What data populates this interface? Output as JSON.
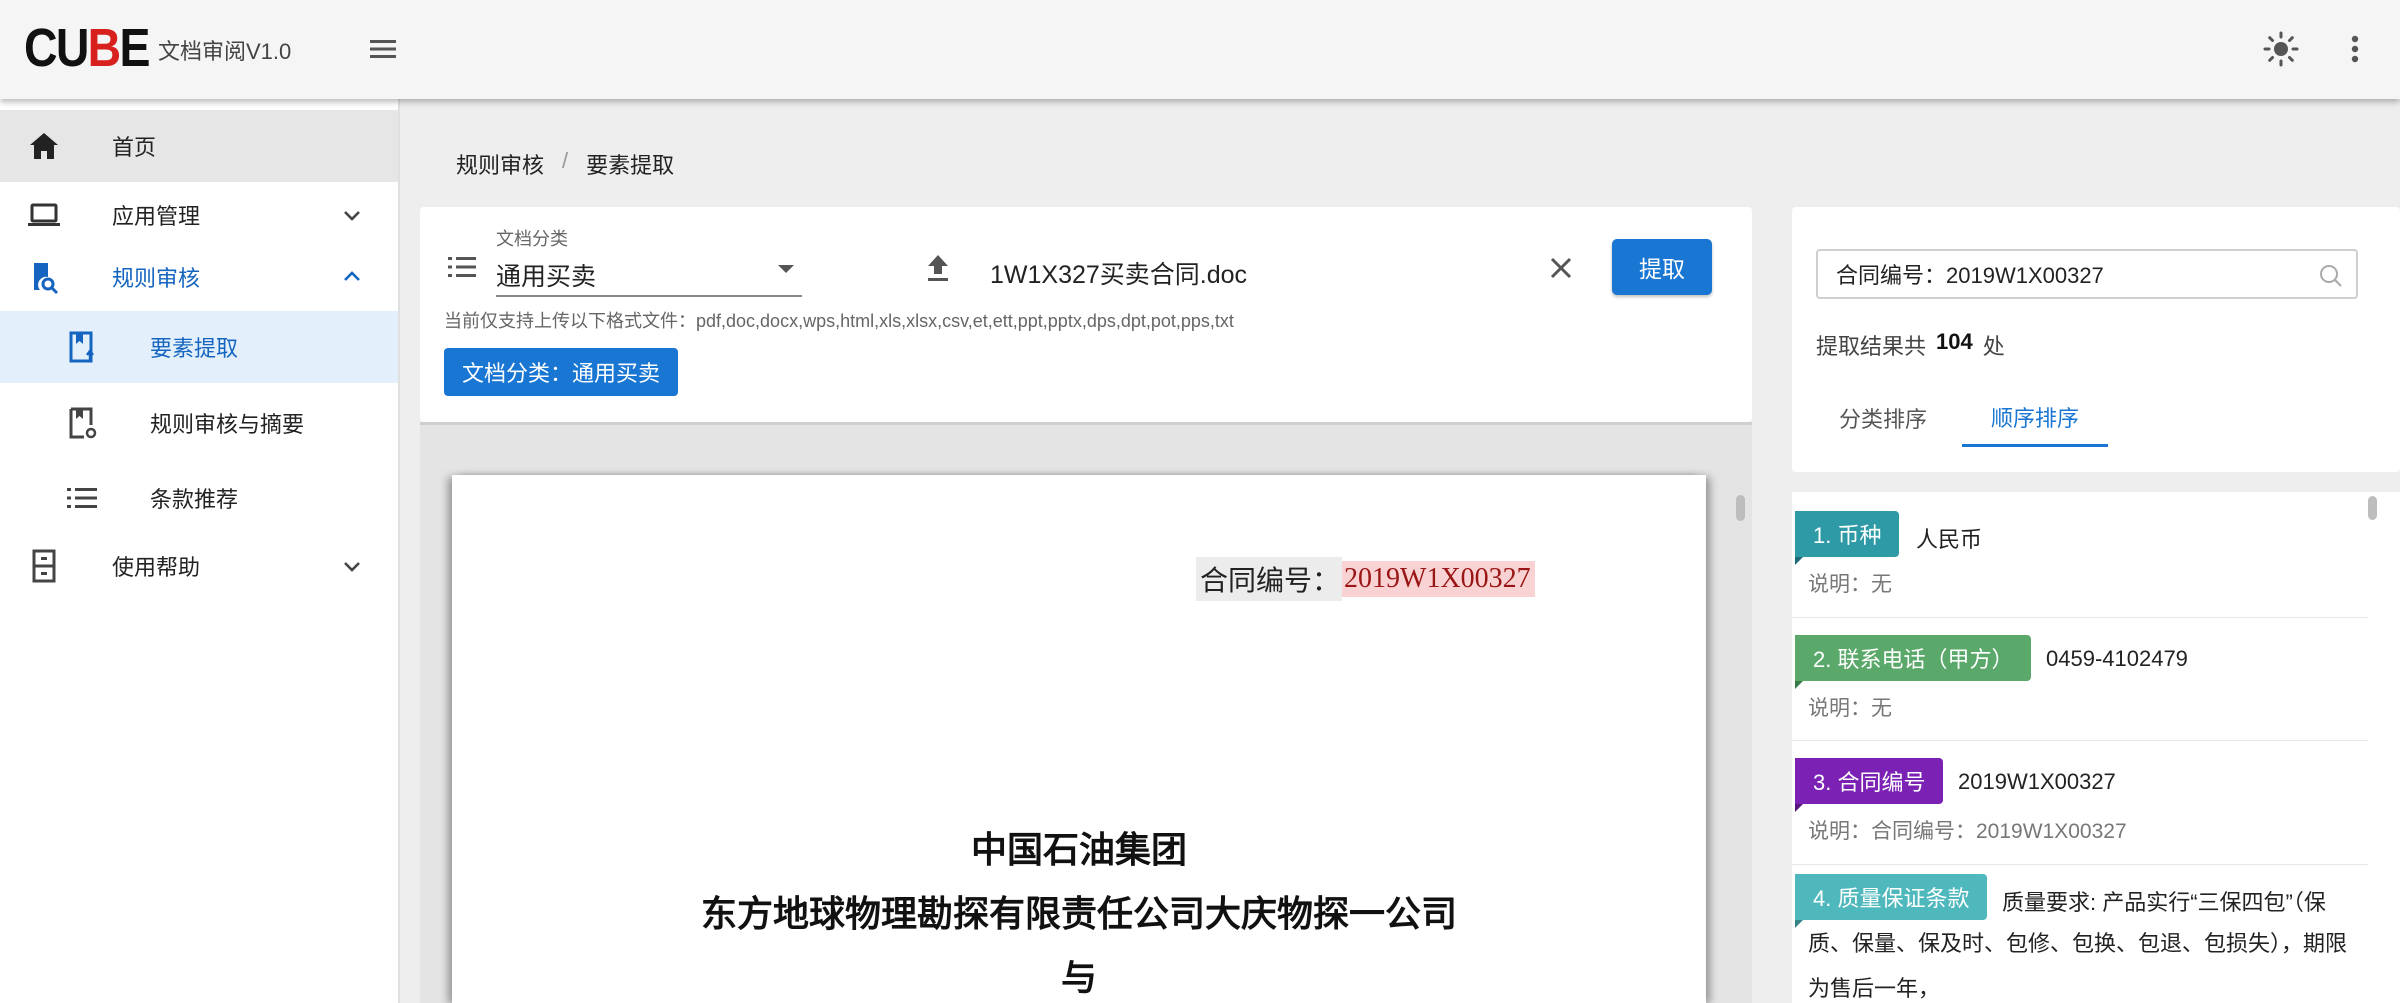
{
  "header": {
    "logo_part1": "CU",
    "logo_part2": "B",
    "logo_part3": "E",
    "app_title": "文档审阅V1.0"
  },
  "sidebar": {
    "items": [
      {
        "label": "首页",
        "icon": "home-icon"
      },
      {
        "label": "应用管理",
        "icon": "laptop-icon"
      },
      {
        "label": "规则审核",
        "icon": "doc-search-icon"
      },
      {
        "label": "要素提取",
        "icon": "bookmark-upload-icon"
      },
      {
        "label": "规则审核与摘要",
        "icon": "doc-gear-icon"
      },
      {
        "label": "条款推荐",
        "icon": "list-icon"
      },
      {
        "label": "使用帮助",
        "icon": "cabinet-icon"
      }
    ]
  },
  "breadcrumb": {
    "parent": "规则审核",
    "separator": "/",
    "current": "要素提取"
  },
  "toolbar": {
    "category_label": "文档分类",
    "category_value": "通用买卖",
    "file_name": "1W1X327买卖合同.doc",
    "extract_label": "提取",
    "hint": "当前仅支持上传以下格式文件：pdf,doc,docx,wps,html,xls,xlsx,csv,et,ett,ppt,pptx,dps,dpt,pot,pps,txt",
    "chip_label": "文档分类：通用买卖"
  },
  "document": {
    "contract_label": "合同编号：",
    "contract_number": "2019W1X00327",
    "line1": "中国石油集团",
    "line2": "东方地球物理勘探有限责任公司大庆物探一公司",
    "line3": "与"
  },
  "results": {
    "search_value": "合同编号：2019W1X00327",
    "count_prefix": "提取结果共",
    "count": "104",
    "count_suffix": "处",
    "tabs": [
      "分类排序",
      "顺序排序"
    ],
    "items": [
      {
        "tag": "1. 币种",
        "value": "人民币",
        "desc": "说明：无",
        "color": "#2e9aa6"
      },
      {
        "tag": "2. 联系电话（甲方）",
        "value": "0459-4102479",
        "desc": "说明：无",
        "color": "#5aa86a"
      },
      {
        "tag": "3. 合同编号",
        "value": "2019W1X00327",
        "desc": "说明：合同编号：2019W1X00327",
        "color": "#7b22b4"
      },
      {
        "tag": "4. 质量保证条款",
        "value": "质量要求: 产品实行“三保四包”（保",
        "desc": "质、保量、保及时、包修、包换、包退、包损失），期限",
        "desc2": "为售后一年，",
        "color": "#4fb8bd"
      }
    ]
  }
}
